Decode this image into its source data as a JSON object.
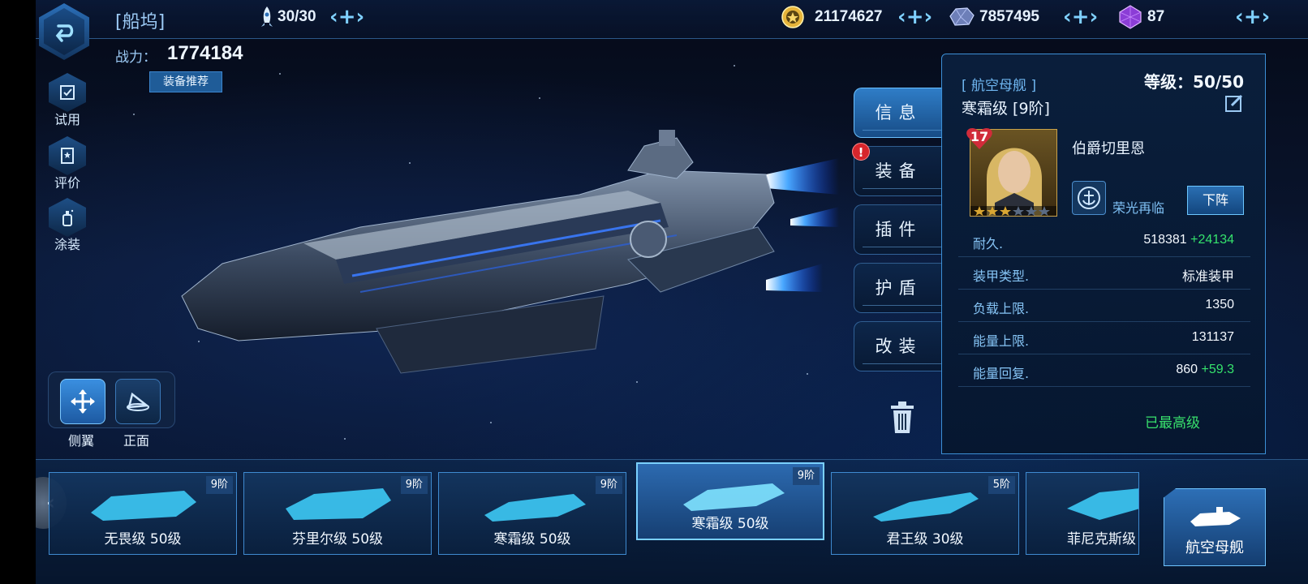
{
  "header": {
    "title": "[船坞]",
    "fuel": "30/30",
    "credits": "21174627",
    "minerals": "7857495",
    "gems": "87"
  },
  "power": {
    "label": "战力：",
    "value": "1774184"
  },
  "equip_recommend": "装备推荐",
  "side_buttons": [
    {
      "label": "试用",
      "icon": "trial-icon"
    },
    {
      "label": "评价",
      "icon": "review-icon"
    },
    {
      "label": "涂装",
      "icon": "paint-icon"
    }
  ],
  "view_buttons": [
    {
      "label": "侧翼",
      "icon": "move-arrows-icon"
    },
    {
      "label": "正面",
      "icon": "front-view-icon"
    }
  ],
  "tabs": [
    {
      "label": "信息",
      "active": true
    },
    {
      "label": "装备",
      "active": false,
      "alert": "!"
    },
    {
      "label": "插件",
      "active": false
    },
    {
      "label": "护盾",
      "active": false
    },
    {
      "label": "改装",
      "active": false
    }
  ],
  "info": {
    "ship_type": "[ 航空母舰 ]",
    "ship_name": "寒霜级 [9阶]",
    "level": "等级：50/50",
    "captain": {
      "level": "17",
      "name": "伯爵切里恩",
      "stars_filled": 3,
      "stars_total": 6
    },
    "skill_name": "荣光再临",
    "unassign_label": "下阵",
    "stats": [
      {
        "key": "耐久.",
        "value": "518381",
        "bonus": "+24134"
      },
      {
        "key": "装甲类型.",
        "value": "标准装甲",
        "bonus": ""
      },
      {
        "key": "负载上限.",
        "value": "1350",
        "bonus": ""
      },
      {
        "key": "能量上限.",
        "value": "131137",
        "bonus": ""
      },
      {
        "key": "能量回复.",
        "value": "860",
        "bonus": "+59.3"
      }
    ],
    "max_level_text": "已最高级"
  },
  "ships": [
    {
      "name": "无畏级 50级",
      "tier": "9阶",
      "selected": false
    },
    {
      "name": "芬里尔级 50级",
      "tier": "9阶",
      "selected": false
    },
    {
      "name": "寒霜级 50级",
      "tier": "9阶",
      "selected": false
    },
    {
      "name": "寒霜级 50级",
      "tier": "9阶",
      "selected": true
    },
    {
      "name": "君王级 30级",
      "tier": "5阶",
      "selected": false
    },
    {
      "name": "菲尼克斯级",
      "tier": "",
      "selected": false
    }
  ],
  "category_button": "航空母舰",
  "colors": {
    "accent": "#3c8fd6",
    "bonus": "#35e26c",
    "alert": "#d7262c"
  }
}
